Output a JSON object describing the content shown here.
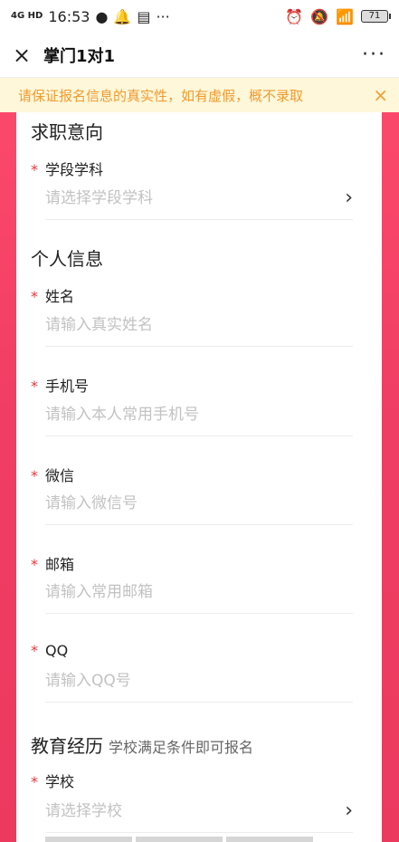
{
  "status": {
    "network": "4G HD",
    "time": "16:53",
    "battery": "71"
  },
  "nav": {
    "title": "掌门1对1",
    "more": "···",
    "close": "×"
  },
  "notice": {
    "text": "请保证报名信息的真实性，如有虚假，概不录取",
    "close": "×"
  },
  "sections": {
    "intent": {
      "title": "求职意向"
    },
    "personal": {
      "title": "个人信息"
    },
    "education": {
      "title": "教育经历",
      "subtitle": "学校满足条件即可报名"
    }
  },
  "fields": {
    "stage": {
      "label": "学段学科",
      "placeholder": "请选择学段学科"
    },
    "name": {
      "label": "姓名",
      "placeholder": "请输入真实姓名"
    },
    "phone": {
      "label": "手机号",
      "placeholder": "请输入本人常用手机号"
    },
    "wechat": {
      "label": "微信",
      "placeholder": "请输入微信号"
    },
    "email": {
      "label": "邮箱",
      "placeholder": "请输入常用邮箱"
    },
    "qq": {
      "label": "QQ",
      "placeholder": "请输入QQ号"
    },
    "school": {
      "label": "学校",
      "placeholder": "请选择学校"
    }
  },
  "icons": {
    "chevron": "chevron-right-icon"
  },
  "colors": {
    "accent": "#ec3a5f",
    "required": "#e4393c",
    "notice_text": "#f09a30",
    "notice_bg": "#fff7d9"
  }
}
